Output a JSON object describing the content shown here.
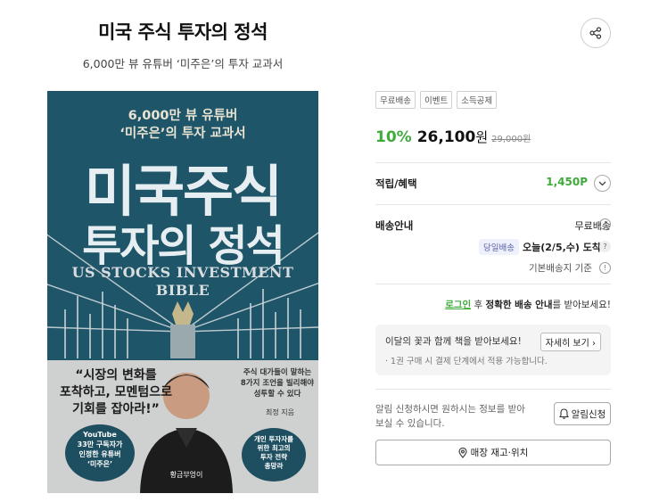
{
  "product": {
    "title": "미국 주식 투자의 정석",
    "subtitle": "6,000만 뷰 유튜버 ‘미주은’의 투자 교과서"
  },
  "cover": {
    "top_line1": "6,000만 뷰 유튜버",
    "top_line2": "‘미주은’의 투자 교과서",
    "title_line1": "미국주식",
    "title_line2": "투자의 정석",
    "eng_line1": "US STOCKS INVESTMENT",
    "eng_line2": "BIBLE",
    "quote_line1": "“시장의 변화를",
    "quote_line2": "포착하고, 모멘텀으로",
    "quote_line3": "기회를 잡아라!”",
    "side_line1": "주식 대가들이 말하는",
    "side_line2": "8가지 조언을 빌리해야",
    "side_line3": "성투할 수 있다",
    "author": "최정 지음",
    "badge_left_line1": "YouTube",
    "badge_left_line2": "33만 구독자가",
    "badge_left_line3": "인정한 유튜버",
    "badge_left_line4": "‘미주은’",
    "badge_right_line1": "개인 투자자를",
    "badge_right_line2": "위한 최고의",
    "badge_right_line3": "투자 전략",
    "badge_right_line4": "총망라",
    "publisher": "황금부엉이"
  },
  "tags": [
    "무료배송",
    "이벤트",
    "소득공제"
  ],
  "pricing": {
    "discount": "10%",
    "price": "26,100",
    "price_unit": "원",
    "original": "29,000원"
  },
  "points": {
    "label": "적립/혜택",
    "value": "1,450P"
  },
  "shipping": {
    "label": "배송안내",
    "free": "무료배송",
    "same_day": "당일배송",
    "date": "오늘(2/5,수) 도착",
    "standard": "기본배송지 기준"
  },
  "login_notice": {
    "login": "로그인",
    "middle": " 후 ",
    "bold": "정확한 배송 안내",
    "tail": "를 받아보세요!"
  },
  "gift": {
    "line1": "이달의 꽃과 함께 책을 받아보세요!",
    "line2": "· 1권 구매 시 결제 단계에서 적용 가능합니다.",
    "detail_button": "자세히 보기"
  },
  "notify": {
    "text": "알림 신청하시면 원하시는 정보를 받아 보실 수 있습니다.",
    "button": "알림신청"
  },
  "store_button": "매장 재고·위치",
  "colors": {
    "accent_green": "#3fab3b",
    "cover_teal": "#1f5568"
  }
}
